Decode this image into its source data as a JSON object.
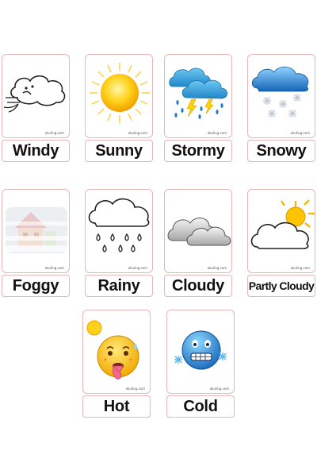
{
  "brand": "okuling.com",
  "cards": [
    {
      "label": "Windy",
      "icon": "wind-cloud-icon"
    },
    {
      "label": "Sunny",
      "icon": "sun-icon"
    },
    {
      "label": "Stormy",
      "icon": "storm-cloud-icon"
    },
    {
      "label": "Snowy",
      "icon": "snow-cloud-icon"
    },
    {
      "label": "Foggy",
      "icon": "fog-house-icon"
    },
    {
      "label": "Rainy",
      "icon": "rain-cloud-icon"
    },
    {
      "label": "Cloudy",
      "icon": "clouds-icon"
    },
    {
      "label": "Partly Cloudy",
      "icon": "partly-cloudy-icon"
    },
    {
      "label": "Hot",
      "icon": "hot-face-icon"
    },
    {
      "label": "Cold",
      "icon": "cold-face-icon"
    }
  ]
}
